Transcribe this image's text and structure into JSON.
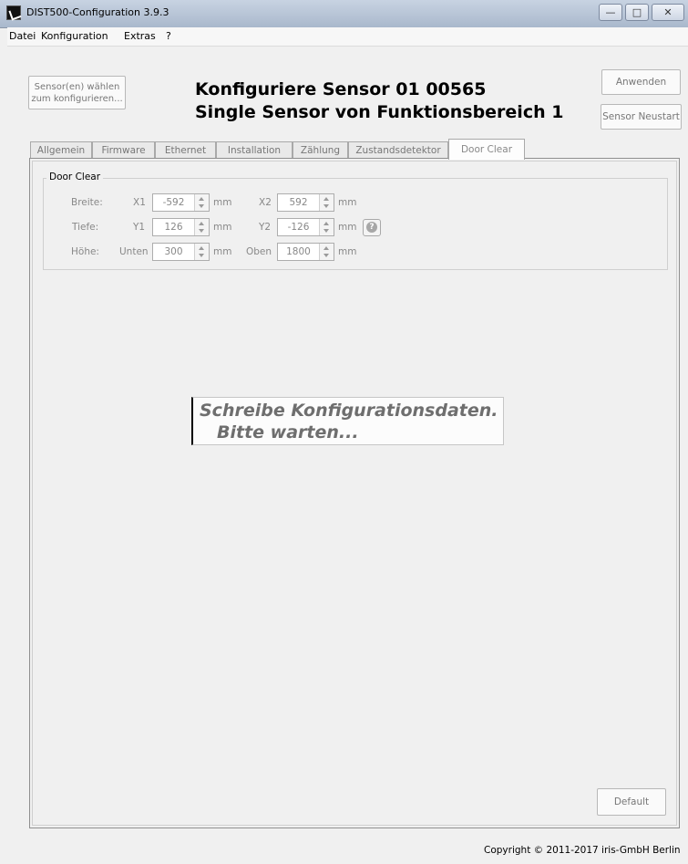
{
  "window": {
    "title": "DIST500-Configuration 3.9.3",
    "controls": {
      "minimize": "—",
      "maximize": "□",
      "close": "✕"
    }
  },
  "menu": {
    "items": [
      "Datei",
      "Konfiguration",
      "Extras",
      "?"
    ]
  },
  "header": {
    "sensor_select_line1": "Sensor(en) wählen",
    "sensor_select_line2": "zum konfigurieren...",
    "title_line1": "Konfiguriere Sensor  01 00565",
    "title_line2": "Single Sensor von Funktionsbereich 1",
    "apply_label": "Anwenden",
    "restart_label": "Sensor Neustart"
  },
  "tabs": [
    {
      "label": "Allgemein"
    },
    {
      "label": "Firmware"
    },
    {
      "label": "Ethernet"
    },
    {
      "label": "Installation"
    },
    {
      "label": "Zählung"
    },
    {
      "label": "Zustandsdetektor"
    },
    {
      "label": "Door Clear",
      "active": true
    }
  ],
  "door_clear": {
    "group_title": "Door Clear",
    "rows": [
      {
        "label": "Breite:",
        "a_label": "X1",
        "a_value": "-592",
        "a_unit": "mm",
        "b_label": "X2",
        "b_value": "592",
        "b_unit": "mm"
      },
      {
        "label": "Tiefe:",
        "a_label": "Y1",
        "a_value": "126",
        "a_unit": "mm",
        "b_label": "Y2",
        "b_value": "-126",
        "b_unit": "mm"
      },
      {
        "label": "Höhe:",
        "a_label": "Unten",
        "a_value": "300",
        "a_unit": "mm",
        "b_label": "Oben",
        "b_value": "1800",
        "b_unit": "mm"
      }
    ],
    "help_icon": "help-icon"
  },
  "status": {
    "line1": "Schreibe Konfigurationsdaten.",
    "line2": "Bitte warten..."
  },
  "footer": {
    "default_label": "Default",
    "copyright": "Copyright © 2011-2017 iris-GmbH Berlin"
  }
}
